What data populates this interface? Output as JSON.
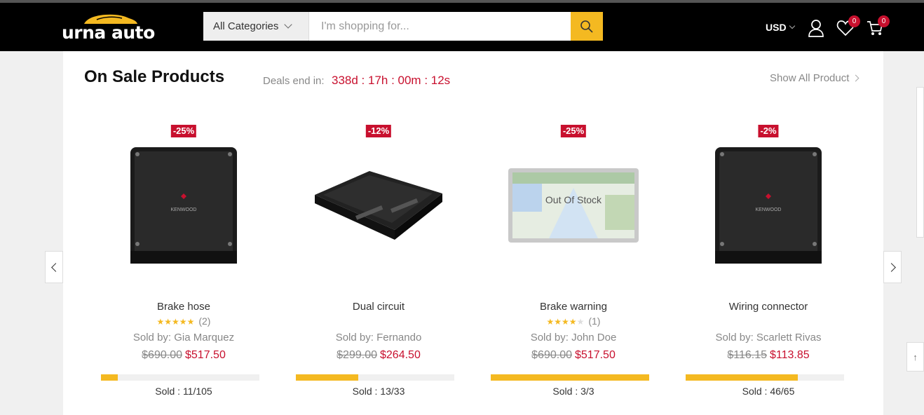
{
  "header": {
    "logo_text": "urna auto",
    "category_select": "All Categories",
    "search_placeholder": "I'm shopping for...",
    "currency": "USD",
    "wishlist_count": "0",
    "cart_count": "0",
    "colors": {
      "bar": "#000000",
      "accent": "#f4b921"
    }
  },
  "section": {
    "title": "On Sale Products",
    "deals_label": "Deals end in:",
    "deals_time": "338d : 17h : 00m : 12s",
    "show_all": "Show All Product"
  },
  "products": [
    {
      "discount": "-25%",
      "name": "Brake hose",
      "stars": 5,
      "rating_count": "(2)",
      "seller": "Sold by: Gia Marquez",
      "old_price": "$690.00",
      "new_price": "$517.50",
      "sold_fraction": 0.1048,
      "sold": "Sold : 11/105",
      "image": "amp-square-icon"
    },
    {
      "discount": "-12%",
      "name": "Dual circuit",
      "seller": "Sold by: Fernando",
      "old_price": "$299.00",
      "new_price": "$264.50",
      "sold_fraction": 0.394,
      "sold": "Sold : 13/33",
      "image": "amp-angled-icon"
    },
    {
      "discount": "-25%",
      "name": "Brake warning",
      "stars": 4,
      "rating_count": "(1)",
      "seller": "Sold by: John Doe",
      "old_price": "$690.00",
      "new_price": "$517.50",
      "sold_fraction": 1.0,
      "sold": "Sold : 3/3",
      "image": "gps-navigator-icon",
      "stock_label": "Out Of Stock"
    },
    {
      "discount": "-2%",
      "name": "Wiring connector",
      "seller": "Sold by: Scarlett Rivas",
      "old_price": "$116.15",
      "new_price": "$113.85",
      "sold_fraction": 0.7077,
      "sold": "Sold : 46/65",
      "image": "amp-square-icon"
    }
  ],
  "amp_brand": "KENWOOD",
  "colors": {
    "sale": "#c8102e",
    "progress": "#f4b921"
  }
}
